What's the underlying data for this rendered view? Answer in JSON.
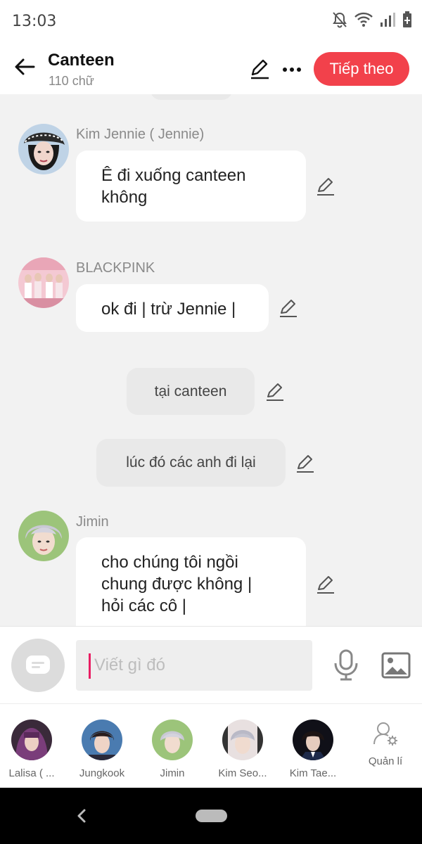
{
  "status": {
    "time": "13:03",
    "icons": [
      "bell-off-icon",
      "wifi-icon",
      "signal-icon",
      "battery-icon"
    ]
  },
  "header": {
    "title": "Canteen",
    "subtitle": "110 chữ",
    "next_label": "Tiếp theo",
    "accent": "#f2414b"
  },
  "messages": [
    {
      "type": "character",
      "sender": "Kim Jennie ( Jennie)",
      "lines": [
        "Ê đi xuống canteen",
        "không"
      ]
    },
    {
      "type": "character",
      "sender": "BLACKPINK",
      "lines": [
        "ok đi | trừ Jennie |"
      ]
    },
    {
      "type": "narration",
      "lines": [
        "tại  canteen"
      ]
    },
    {
      "type": "narration",
      "lines": [
        "lúc đó các anh đi lại"
      ]
    },
    {
      "type": "character",
      "sender": "Jimin",
      "lines": [
        "cho chúng tôi ngồi",
        "chung được không |",
        "hỏi các cô |"
      ]
    }
  ],
  "input": {
    "placeholder": "Viết gì đó"
  },
  "characters": [
    {
      "name": "Lalisa ( ..."
    },
    {
      "name": "Jungkook"
    },
    {
      "name": "Jimin"
    },
    {
      "name": "Kim Seo..."
    },
    {
      "name": "Kim Tae..."
    }
  ],
  "manage_label": "Quản lí"
}
